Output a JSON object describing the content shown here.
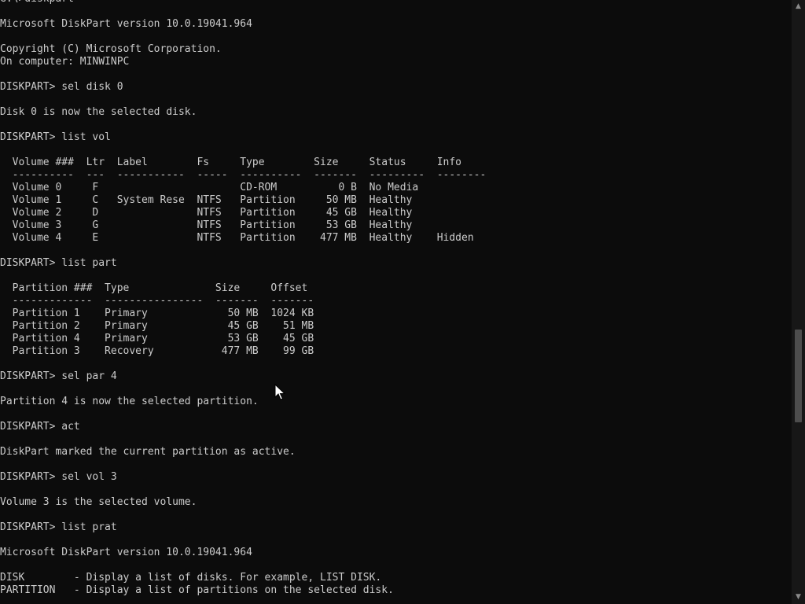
{
  "console": {
    "lines": [
      "G:\\>diskpart",
      "",
      "Microsoft DiskPart version 10.0.19041.964",
      "",
      "Copyright (C) Microsoft Corporation.",
      "On computer: MINWINPC",
      "",
      "DISKPART> sel disk 0",
      "",
      "Disk 0 is now the selected disk.",
      "",
      "DISKPART> list vol",
      "",
      "  Volume ###  Ltr  Label        Fs     Type        Size     Status     Info",
      "  ----------  ---  -----------  -----  ----------  -------  ---------  --------",
      "  Volume 0     F                       CD-ROM          0 B  No Media",
      "  Volume 1     C   System Rese  NTFS   Partition     50 MB  Healthy",
      "  Volume 2     D                NTFS   Partition     45 GB  Healthy",
      "  Volume 3     G                NTFS   Partition     53 GB  Healthy",
      "  Volume 4     E                NTFS   Partition    477 MB  Healthy    Hidden",
      "",
      "DISKPART> list part",
      "",
      "  Partition ###  Type              Size     Offset",
      "  -------------  ----------------  -------  -------",
      "  Partition 1    Primary             50 MB  1024 KB",
      "  Partition 2    Primary             45 GB    51 MB",
      "  Partition 4    Primary             53 GB    45 GB",
      "  Partition 3    Recovery           477 MB    99 GB",
      "",
      "DISKPART> sel par 4",
      "",
      "Partition 4 is now the selected partition.",
      "",
      "DISKPART> act",
      "",
      "DiskPart marked the current partition as active.",
      "",
      "DISKPART> sel vol 3",
      "",
      "Volume 3 is the selected volume.",
      "",
      "DISKPART> list prat",
      "",
      "Microsoft DiskPart version 10.0.19041.964",
      "",
      "DISK        - Display a list of disks. For example, LIST DISK.",
      "PARTITION   - Display a list of partitions on the selected disk."
    ]
  },
  "scrollbar": {
    "position_fraction": 0.73,
    "up_arrow_icon": "triangle-up-icon",
    "down_arrow_icon": "triangle-down-icon"
  },
  "colors": {
    "background": "#0c0c0c",
    "text": "#cccccc",
    "scroll_track": "#171717",
    "scroll_thumb": "#4d4d4d"
  }
}
